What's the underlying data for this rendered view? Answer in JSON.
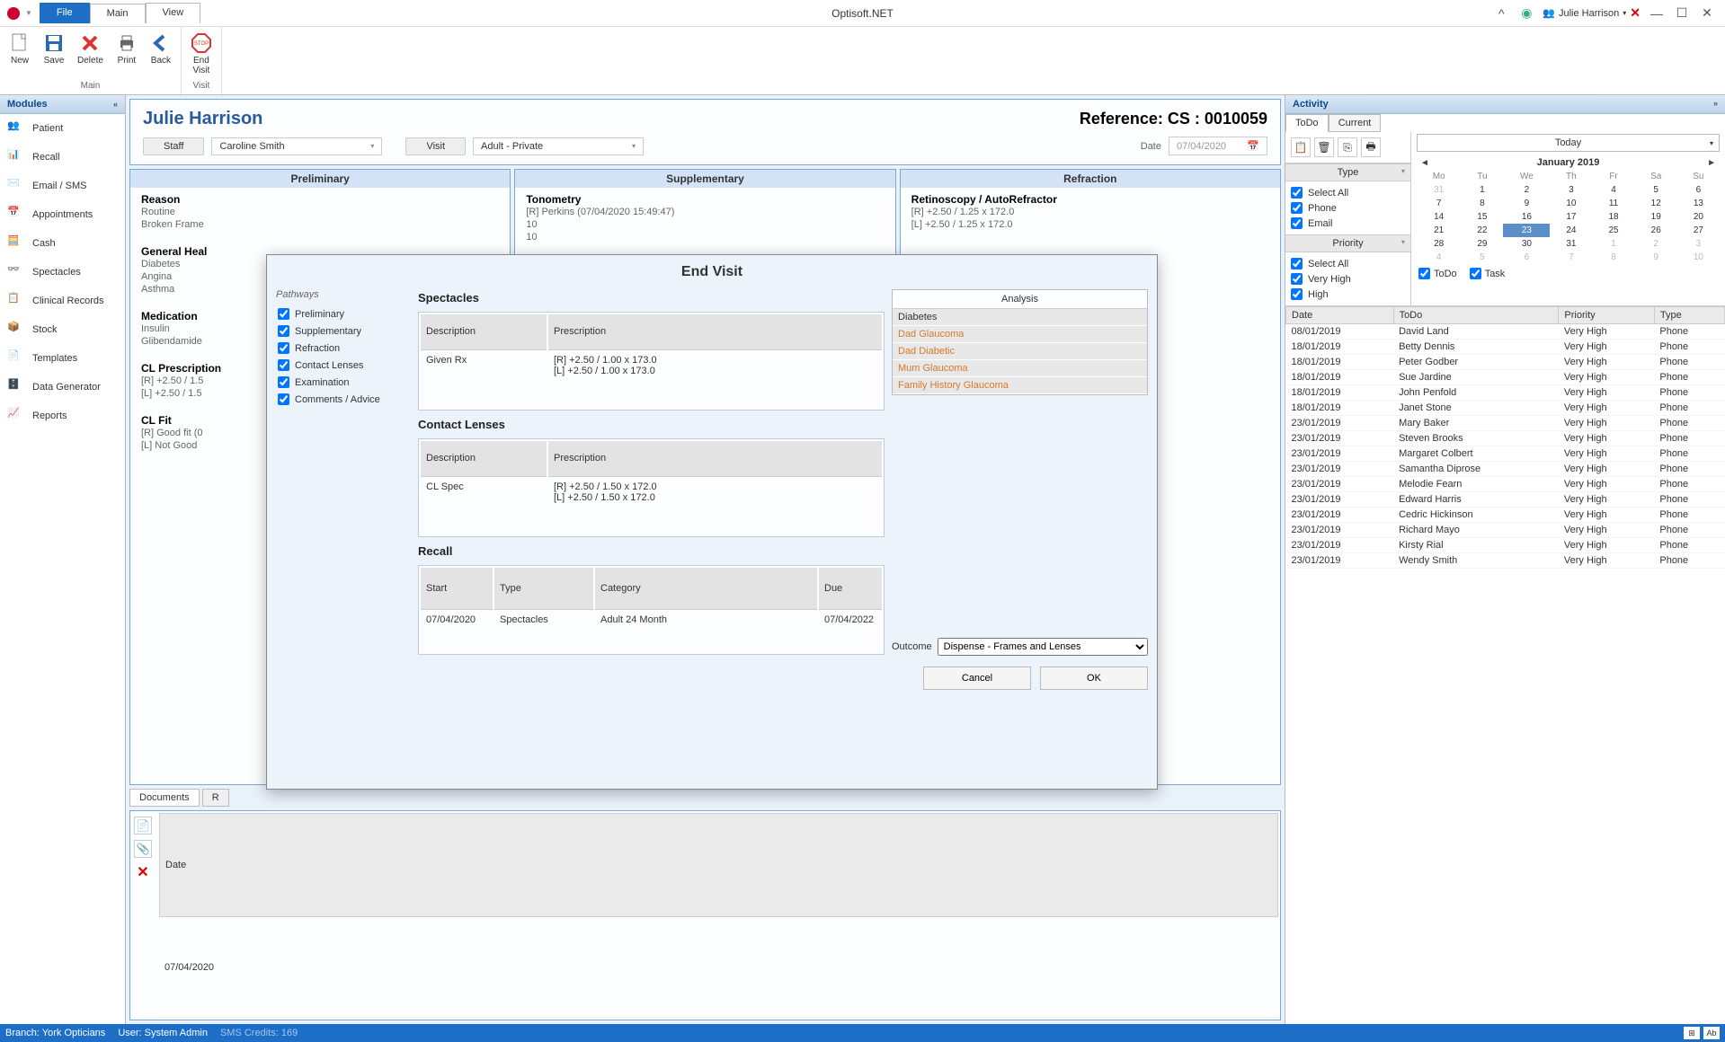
{
  "app": {
    "title": "Optisoft.NET"
  },
  "ribbon_tabs": {
    "file": "File",
    "main": "Main",
    "view": "View"
  },
  "user": {
    "name": "Julie Harrison"
  },
  "ribbon": {
    "group1": "Main",
    "group2": "Visit",
    "new": "New",
    "save": "Save",
    "delete": "Delete",
    "print": "Print",
    "back": "Back",
    "endvisit": "End\nVisit"
  },
  "modules": {
    "header": "Modules",
    "items": [
      {
        "label": "Patient"
      },
      {
        "label": "Recall"
      },
      {
        "label": "Email / SMS"
      },
      {
        "label": "Appointments"
      },
      {
        "label": "Cash"
      },
      {
        "label": "Spectacles"
      },
      {
        "label": "Clinical Records"
      },
      {
        "label": "Stock"
      },
      {
        "label": "Templates"
      },
      {
        "label": "Data Generator"
      },
      {
        "label": "Reports"
      }
    ]
  },
  "patient": {
    "name": "Julie Harrison",
    "reference": "Reference: CS : 0010059",
    "staff_label": "Staff",
    "staff_value": "Caroline Smith",
    "visit_label": "Visit",
    "visit_value": "Adult - Private",
    "date_label": "Date",
    "date_value": "07/04/2020"
  },
  "exam": {
    "col1_title": "Preliminary",
    "col2_title": "Supplementary",
    "col3_title": "Refraction",
    "reason_h": "Reason",
    "reason_l1": "Routine",
    "reason_l2": "Broken Frame",
    "gh_h": "General Heal",
    "gh_l1": "Diabetes",
    "gh_l2": "Angina",
    "gh_l3": "Asthma",
    "med_h": "Medication",
    "med_l1": "Insulin",
    "med_l2": "Glibendamide",
    "clp_h": "CL Prescription",
    "clp_l1": "[R] +2.50 / 1.5",
    "clp_l2": "[L] +2.50 / 1.5",
    "clf_h": "CL Fit",
    "clf_l1": "[R] Good fit (0",
    "clf_l2": "[L] Not Good",
    "ton_h": "Tonometry",
    "ton_l1": "[R] Perkins (07/04/2020 15:49:47)",
    "ton_l2": "10",
    "ton_l3": "10",
    "ret_h": "Retinoscopy / AutoRefractor",
    "ret_l1": "[R] +2.50 / 1.25 x 172.0",
    "ret_l2": "[L] +2.50 / 1.25 x 172.0"
  },
  "documents": {
    "tab1": "Documents",
    "tab2": "R",
    "col_date": "Date",
    "row_date": "07/04/2020"
  },
  "activity": {
    "header": "Activity",
    "tab_todo": "ToDo",
    "tab_current": "Current",
    "type_h": "Type",
    "priority_h": "Priority",
    "opt_selectall": "Select All",
    "opt_phone": "Phone",
    "opt_email": "Email",
    "opt_vhigh": "Very High",
    "opt_high": "High",
    "today": "Today",
    "month": "January 2019",
    "chk_todo": "ToDo",
    "chk_task": "Task",
    "list_cols": {
      "date": "Date",
      "todo": "ToDo",
      "priority": "Priority",
      "type": "Type"
    },
    "rows": [
      {
        "date": "08/01/2019",
        "todo": "David Land",
        "priority": "Very High",
        "type": "Phone"
      },
      {
        "date": "18/01/2019",
        "todo": "Betty Dennis",
        "priority": "Very High",
        "type": "Phone"
      },
      {
        "date": "18/01/2019",
        "todo": "Peter Godber",
        "priority": "Very High",
        "type": "Phone"
      },
      {
        "date": "18/01/2019",
        "todo": "Sue Jardine",
        "priority": "Very High",
        "type": "Phone"
      },
      {
        "date": "18/01/2019",
        "todo": "John Penfold",
        "priority": "Very High",
        "type": "Phone"
      },
      {
        "date": "18/01/2019",
        "todo": "Janet Stone",
        "priority": "Very High",
        "type": "Phone"
      },
      {
        "date": "23/01/2019",
        "todo": "Mary Baker",
        "priority": "Very High",
        "type": "Phone"
      },
      {
        "date": "23/01/2019",
        "todo": "Steven Brooks",
        "priority": "Very High",
        "type": "Phone"
      },
      {
        "date": "23/01/2019",
        "todo": "Margaret Colbert",
        "priority": "Very High",
        "type": "Phone"
      },
      {
        "date": "23/01/2019",
        "todo": "Samantha Diprose",
        "priority": "Very High",
        "type": "Phone"
      },
      {
        "date": "23/01/2019",
        "todo": "Melodie Fearn",
        "priority": "Very High",
        "type": "Phone"
      },
      {
        "date": "23/01/2019",
        "todo": "Edward Harris",
        "priority": "Very High",
        "type": "Phone"
      },
      {
        "date": "23/01/2019",
        "todo": "Cedric Hickinson",
        "priority": "Very High",
        "type": "Phone"
      },
      {
        "date": "23/01/2019",
        "todo": "Richard Mayo",
        "priority": "Very High",
        "type": "Phone"
      },
      {
        "date": "23/01/2019",
        "todo": "Kirsty Rial",
        "priority": "Very High",
        "type": "Phone"
      },
      {
        "date": "23/01/2019",
        "todo": "Wendy Smith",
        "priority": "Very High",
        "type": "Phone"
      }
    ]
  },
  "calendar": {
    "dow": [
      "Mo",
      "Tu",
      "We",
      "Th",
      "Fr",
      "Sa",
      "Su"
    ],
    "weeks": [
      [
        "31",
        "1",
        "2",
        "3",
        "4",
        "5",
        "6"
      ],
      [
        "7",
        "8",
        "9",
        "10",
        "11",
        "12",
        "13"
      ],
      [
        "14",
        "15",
        "16",
        "17",
        "18",
        "19",
        "20"
      ],
      [
        "21",
        "22",
        "23",
        "24",
        "25",
        "26",
        "27"
      ],
      [
        "28",
        "29",
        "30",
        "31",
        "1",
        "2",
        "3"
      ],
      [
        "4",
        "5",
        "6",
        "7",
        "8",
        "9",
        "10"
      ]
    ],
    "sel_row": 3,
    "sel_col": 2
  },
  "modal": {
    "title": "End Visit",
    "pathways_h": "Pathways",
    "pathways": [
      "Preliminary",
      "Supplementary",
      "Refraction",
      "Contact Lenses",
      "Examination",
      "Comments / Advice"
    ],
    "spectacles_h": "Spectacles",
    "desc_col": "Description",
    "presc_col": "Prescription",
    "spec_desc": "Given Rx",
    "spec_presc1": "[R] +2.50 / 1.00 x 173.0",
    "spec_presc2": "[L] +2.50 / 1.00 x 173.0",
    "cl_h": "Contact Lenses",
    "cl_desc": "CL Spec",
    "cl_presc1": "[R] +2.50 / 1.50 x 172.0",
    "cl_presc2": "[L] +2.50 / 1.50 x 172.0",
    "recall_h": "Recall",
    "recall_cols": {
      "start": "Start",
      "type": "Type",
      "category": "Category",
      "due": "Due"
    },
    "recall_row": {
      "start": "07/04/2020",
      "type": "Spectacles",
      "category": "Adult 24 Month",
      "due": "07/04/2022"
    },
    "analysis_h": "Analysis",
    "analysis": [
      {
        "text": "Diabetes",
        "warn": false
      },
      {
        "text": "Dad Glaucoma",
        "warn": true
      },
      {
        "text": "Dad Diabetic",
        "warn": true
      },
      {
        "text": "Mum Glaucoma",
        "warn": true
      },
      {
        "text": "Family History Glaucoma",
        "warn": true
      }
    ],
    "outcome_label": "Outcome",
    "outcome_value": "Dispense - Frames and Lenses",
    "cancel": "Cancel",
    "ok": "OK"
  },
  "status": {
    "branch_label": "Branch:",
    "branch": "York Opticians",
    "user_label": "User:",
    "user": "System Admin",
    "sms_label": "SMS Credits:",
    "sms": "169"
  }
}
